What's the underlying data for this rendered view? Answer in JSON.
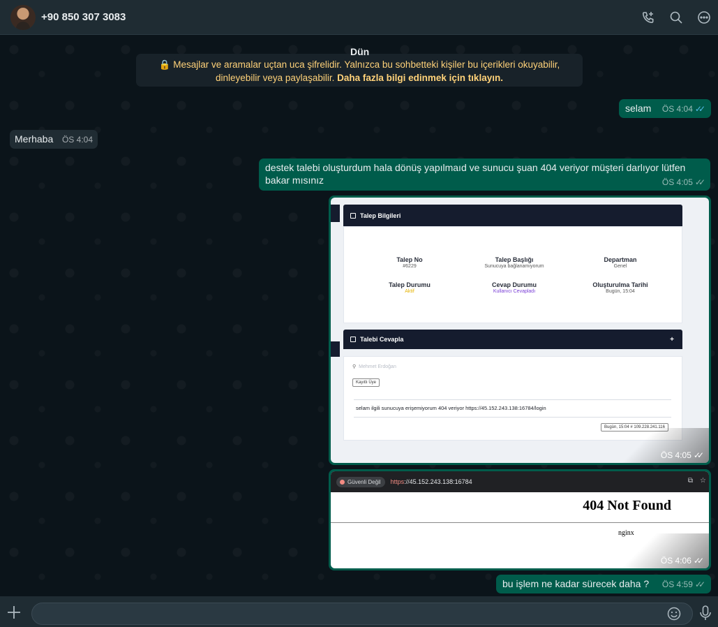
{
  "header": {
    "contact_name": "+90 850 307 3083",
    "icons": [
      "add-call-icon",
      "search-icon",
      "more-options-icon"
    ]
  },
  "chat": {
    "day_label": "Dün",
    "encryption_notice": "Mesajlar ve aramalar uçtan uca şifrelidir. Yalnızca bu sohbetteki kişiler bu içerikleri okuyabilir, dinleyebilir veya paylaşabilir.",
    "encryption_link": "Daha fazla bilgi edinmek için tıklayın.",
    "messages": [
      {
        "text": "selam",
        "time": "ÖS 4:04",
        "direction": "out",
        "status": "read"
      },
      {
        "text": "Merhaba",
        "time": "ÖS 4:04",
        "direction": "in"
      },
      {
        "text": "destek talebi oluşturdum hala dönüş yapılmaıd ve sunucu şuan 404 veriyor müşteri darlıyor lütfen bakar mısınız",
        "time": "ÖS 4:05",
        "direction": "out",
        "status": "delivered"
      },
      {
        "type": "image",
        "time": "ÖS 4:05",
        "direction": "out",
        "status": "delivered"
      },
      {
        "type": "image",
        "time": "ÖS 4:06",
        "direction": "out",
        "status": "delivered"
      },
      {
        "text": "bu işlem ne kadar sürecek daha ?",
        "time": "ÖS 4:59",
        "direction": "out",
        "status": "delivered"
      }
    ]
  },
  "screenshot1": {
    "info_header": "Talep Bilgileri",
    "fields": [
      {
        "label": "Talep No",
        "value": "#6229"
      },
      {
        "label": "Talep Başlığı",
        "value": "Sunucuya bağlanamıyorum"
      },
      {
        "label": "Departman",
        "value": "Genel"
      },
      {
        "label": "Talep Durumu",
        "value": "Aktif"
      },
      {
        "label": "Cevap Durumu",
        "value": "Kullanıcı Cevapladı"
      },
      {
        "label": "Oluşturulma Tarihi",
        "value": "Bugün, 15:04"
      }
    ],
    "reply_header": "Talebi Cevapla",
    "reply_plus": "+",
    "user_name": "Mehmet Erdoğan",
    "user_badge": "Kayıtlı Üye",
    "message": "selam ilgili sunucuya erişemiyorum 404 veriyor https://45.152.243.138:16784/login",
    "message_meta": "Bugün, 15:04 # 109.228.241.116"
  },
  "screenshot2": {
    "security_label": "Güvenli Değil",
    "url_scheme": "https",
    "url_rest": "://45.152.243.138:16784",
    "title": "404 Not Found",
    "server": "nginx"
  },
  "footer": {
    "input_placeholder": ""
  },
  "colors": {
    "outgoing_bubble": "#005c4b",
    "incoming_bubble": "#202c33",
    "read_ticks": "#53bdeb",
    "notice_text": "#ffd279"
  }
}
